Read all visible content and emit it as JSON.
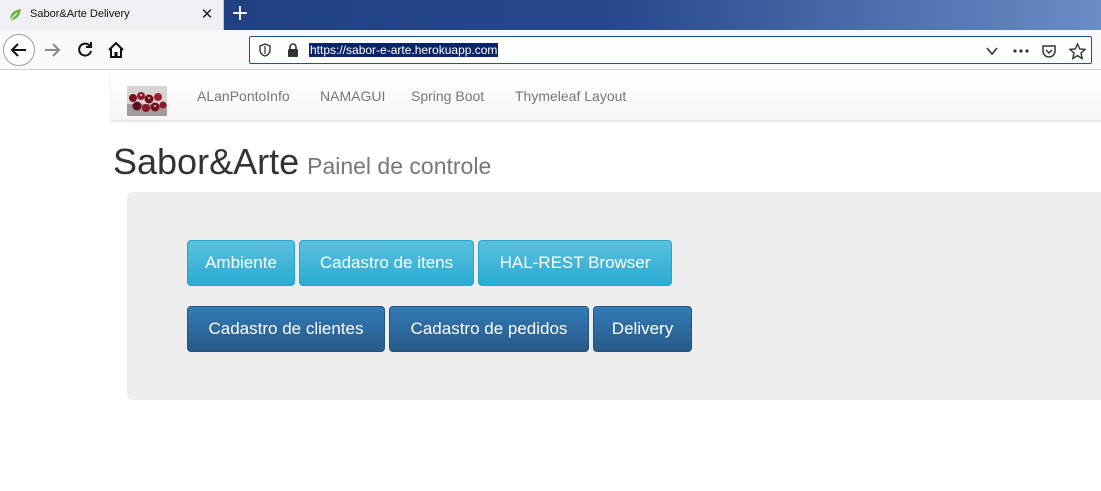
{
  "browser": {
    "tab": {
      "title": "Sabor&Arte Delivery",
      "close": "✕",
      "favicon": "spring-leaf-icon"
    },
    "new_tab": "+",
    "url": "https://sabor-e-arte.herokuapp.com",
    "icons": [
      "back-arrow-icon",
      "forward-arrow-icon",
      "reload-icon",
      "home-icon",
      "shield-icon",
      "lock-icon",
      "chevron-down-icon",
      "more-icon",
      "pocket-icon",
      "star-icon"
    ]
  },
  "site_nav": {
    "brand": "brand-logo-image",
    "links": [
      "ALanPontoInfo",
      "NAMAGUI",
      "Spring Boot",
      "Thymeleaf Layout"
    ]
  },
  "header": {
    "title": "Sabor&Arte",
    "subtitle": "Painel de controle"
  },
  "panel": {
    "row1": [
      "Ambiente",
      "Cadastro de itens",
      "HAL-REST Browser"
    ],
    "row2": [
      "Cadastro de clientes",
      "Cadastro de pedidos",
      "Delivery"
    ]
  },
  "colors": {
    "info": "#5bc0de",
    "primary": "#337ab7",
    "jumbotron": "#eeeeee"
  }
}
